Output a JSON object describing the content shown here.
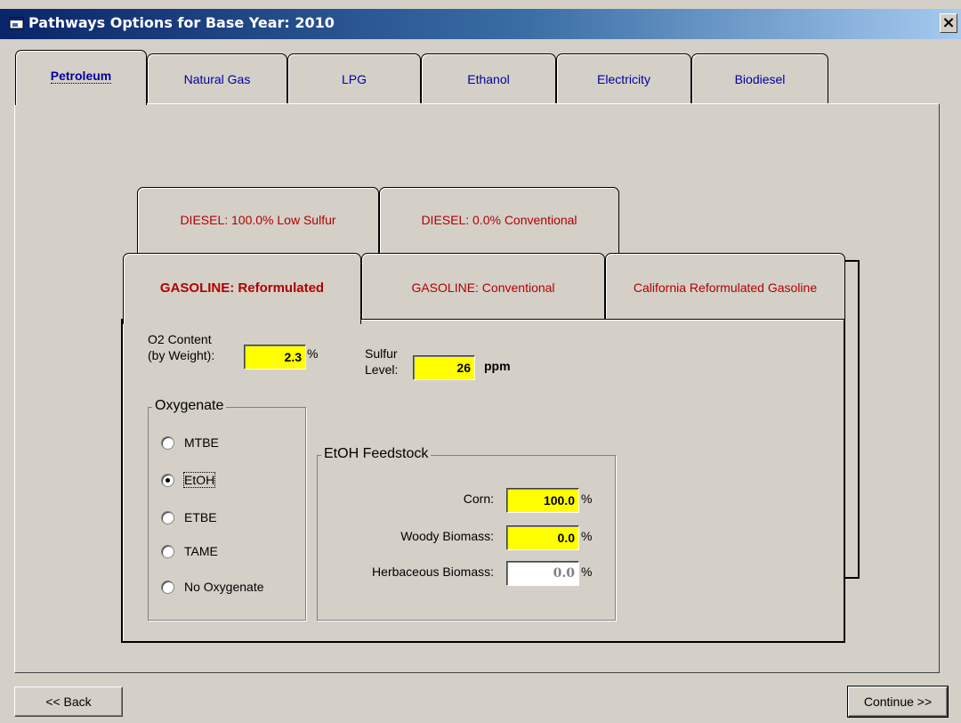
{
  "window": {
    "title": "Pathways Options for Base Year: 2010",
    "close_label": "×"
  },
  "main_tabs": [
    {
      "label": "Petroleum",
      "active": true
    },
    {
      "label": "Natural Gas",
      "active": false
    },
    {
      "label": "LPG",
      "active": false
    },
    {
      "label": "Ethanol",
      "active": false
    },
    {
      "label": "Electricity",
      "active": false
    },
    {
      "label": "Biodiesel",
      "active": false
    }
  ],
  "diesel_tabs": [
    {
      "label": "DIESEL: 100.0% Low Sulfur"
    },
    {
      "label": "DIESEL: 0.0% Conventional"
    }
  ],
  "gasoline_tabs": [
    {
      "label": "GASOLINE: Reformulated",
      "active": true
    },
    {
      "label": "GASOLINE: Conventional",
      "active": false
    },
    {
      "label": "California Reformulated Gasoline",
      "active": false
    }
  ],
  "o2": {
    "label_line1": "O2 Content",
    "label_line2": "(by Weight):",
    "value": "2.3",
    "unit": "%"
  },
  "sulfur": {
    "label_line1": "Sulfur",
    "label_line2": "Level:",
    "value": "26",
    "unit": "ppm"
  },
  "oxygenate": {
    "title": "Oxygenate",
    "options": [
      {
        "label": "MTBE",
        "checked": false
      },
      {
        "label": "EtOH",
        "checked": true
      },
      {
        "label": "ETBE",
        "checked": false
      },
      {
        "label": "TAME",
        "checked": false
      },
      {
        "label": "No Oxygenate",
        "checked": false
      }
    ]
  },
  "feedstock": {
    "title": "EtOH Feedstock",
    "rows": [
      {
        "label": "Corn:",
        "value": "100.0",
        "unit": "%"
      },
      {
        "label": "Woody Biomass:",
        "value": "0.0",
        "unit": "%"
      },
      {
        "label": "Herbaceous Biomass:",
        "value": "0.0",
        "unit": "%"
      }
    ]
  },
  "buttons": {
    "back": "<< Back",
    "continue": "Continue >>"
  },
  "colors": {
    "field_yellow": "#ffff00",
    "tab_red": "#b00000",
    "tab_blue": "#0000a0",
    "titlebar_dark": "#0a246a"
  }
}
